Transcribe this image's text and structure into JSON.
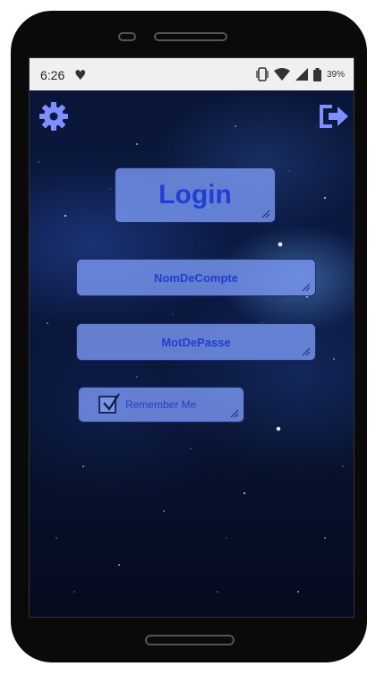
{
  "status_bar": {
    "time": "6:26",
    "battery_percent": "39%",
    "icons": [
      "heart-icon",
      "vibrate-icon",
      "wifi-icon",
      "signal-icon",
      "battery-icon"
    ]
  },
  "toolbar": {
    "settings_icon": "gear-icon",
    "logout_icon": "logout-icon"
  },
  "login": {
    "title": "Login",
    "username_placeholder": "NomDeCompte",
    "password_placeholder": "MotDePasse",
    "remember_label": "Remember Me",
    "remember_checked": true
  },
  "colors": {
    "accent": "#1f3fcf",
    "box_fill": "#7f97f0",
    "icon": "#7e90ff",
    "status_bar": "#eef0f2"
  }
}
